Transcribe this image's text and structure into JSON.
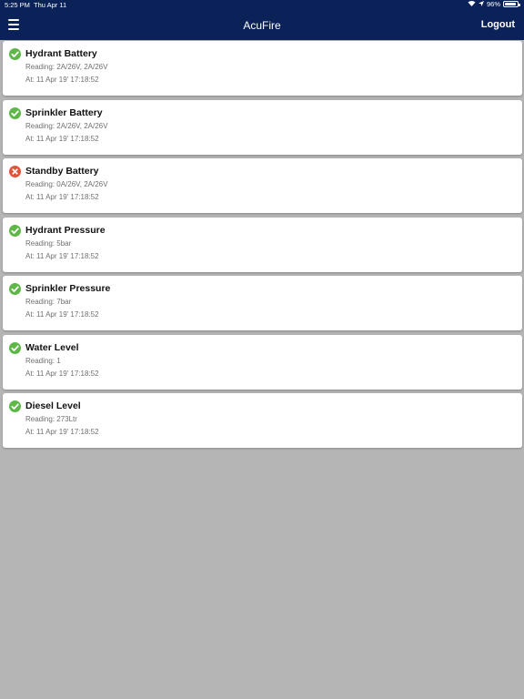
{
  "statusbar": {
    "time": "5:25 PM",
    "date": "Thu Apr 11",
    "battery": "96%",
    "battery_level": 0.96
  },
  "navbar": {
    "title": "AcuFire",
    "logout": "Logout"
  },
  "colors": {
    "header": "#0b2258",
    "ok": "#5fb649",
    "error": "#e0553a",
    "background": "#b5b5b5"
  },
  "items": [
    {
      "title": "Hydrant Battery",
      "reading": "Reading: 2A/26V,  2A/26V",
      "time": "At: 11 Apr 19' 17:18:52",
      "status": "ok"
    },
    {
      "title": "Sprinkler Battery",
      "reading": "Reading: 2A/26V,  2A/26V",
      "time": "At: 11 Apr 19' 17:18:52",
      "status": "ok"
    },
    {
      "title": "Standby Battery",
      "reading": "Reading: 0A/26V,  2A/26V",
      "time": "At: 11 Apr 19' 17:18:52",
      "status": "error"
    },
    {
      "title": "Hydrant Pressure",
      "reading": "Reading: 5bar",
      "time": "At: 11 Apr 19' 17:18:52",
      "status": "ok"
    },
    {
      "title": "Sprinkler Pressure",
      "reading": "Reading: 7bar",
      "time": "At: 11 Apr 19' 17:18:52",
      "status": "ok"
    },
    {
      "title": "Water Level",
      "reading": "Reading: 1",
      "time": "At: 11 Apr 19' 17:18:52",
      "status": "ok"
    },
    {
      "title": "Diesel Level",
      "reading": "Reading: 273Ltr",
      "time": "At: 11 Apr 19' 17:18:52",
      "status": "ok"
    }
  ]
}
